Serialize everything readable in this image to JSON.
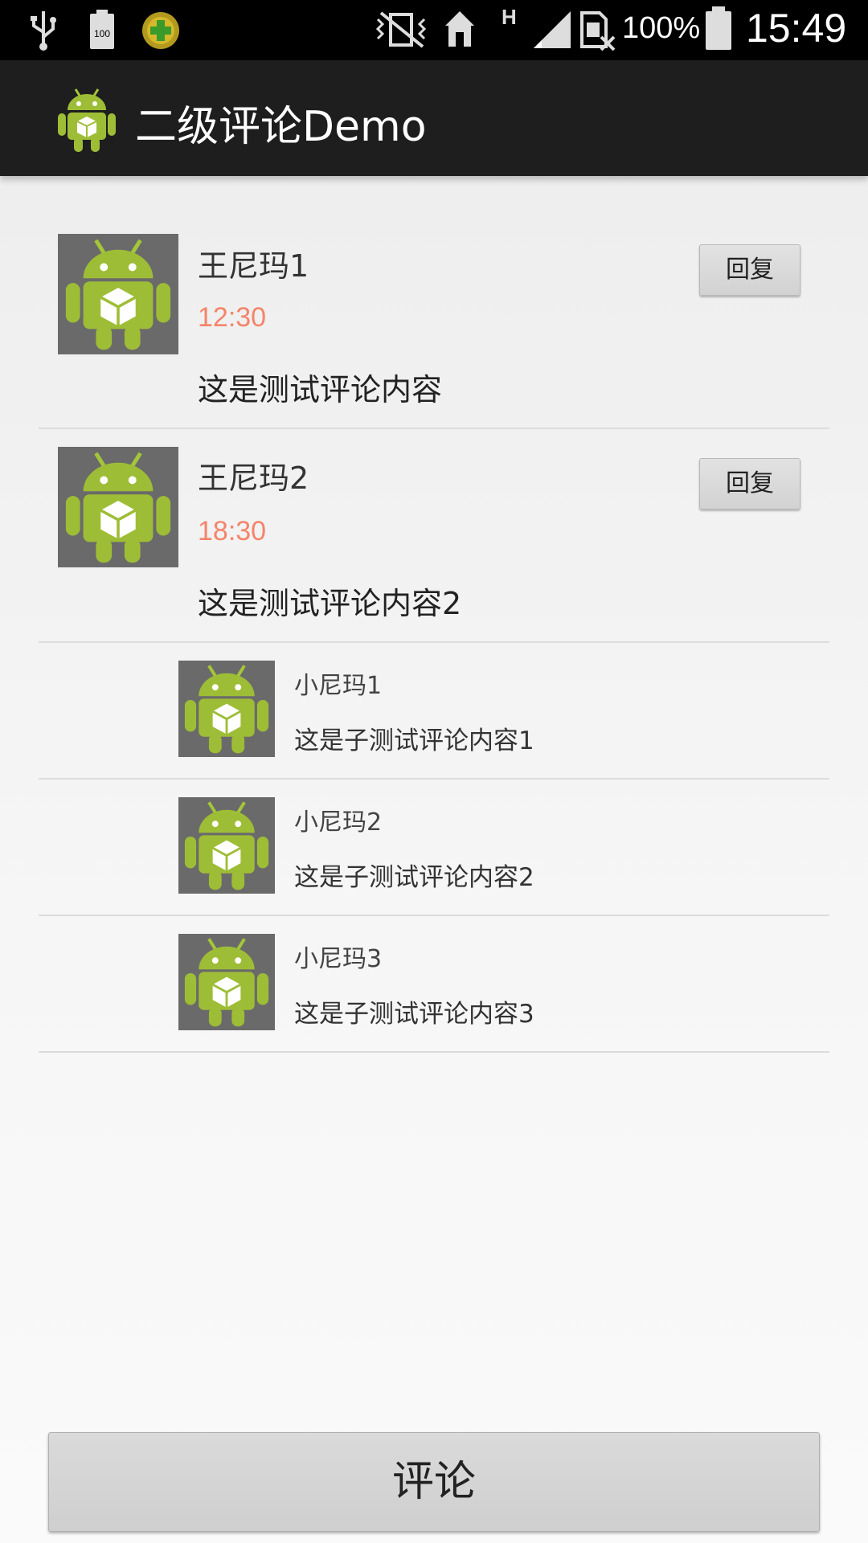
{
  "status_bar": {
    "battery_percent": "100%",
    "time": "15:49",
    "small_battery_label": "100"
  },
  "action_bar": {
    "title": "二级评论Demo"
  },
  "comments": [
    {
      "name": "王尼玛1",
      "time": "12:30",
      "content": "这是测试评论内容",
      "reply_label": "回复"
    },
    {
      "name": "王尼玛2",
      "time": "18:30",
      "content": "这是测试评论内容2",
      "reply_label": "回复"
    }
  ],
  "sub_comments": [
    {
      "name": "小尼玛1",
      "content": "这是子测试评论内容1"
    },
    {
      "name": "小尼玛2",
      "content": "这是子测试评论内容2"
    },
    {
      "name": "小尼玛3",
      "content": "这是子测试评论内容3"
    }
  ],
  "bottom": {
    "comment_label": "评论"
  },
  "colors": {
    "time_text": "#f4846a",
    "action_bar_bg": "#1e1e1e",
    "android_green": "#a4c639"
  }
}
